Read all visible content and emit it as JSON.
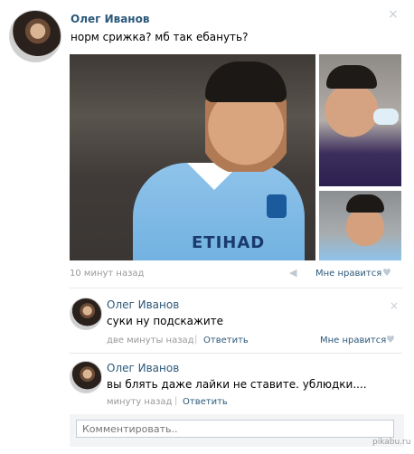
{
  "post": {
    "author": "Олег Иванов",
    "text": "норм срижка? мб так ебануть?",
    "time": "10 минут назад",
    "like_label": "Мне нравится",
    "close_icon": "×",
    "main_photo_sponsor": "ETIHAD"
  },
  "comments": [
    {
      "author": "Олег Иванов",
      "text": "суки ну подскажите",
      "time": "две минуты назад",
      "reply_label": "Ответить",
      "like_label": "Мне нравится",
      "separator": "|"
    },
    {
      "author": "Олег Иванов",
      "text": "вы блять даже лайки не ставите. ублюдки....",
      "time": "минуту назад",
      "reply_label": "Ответить",
      "separator": "|"
    }
  ],
  "comment_input": {
    "placeholder": "Комментировать.."
  },
  "watermark": "pikabu.ru",
  "icons": {
    "heart": "♥",
    "megaphone": "◀",
    "close": "×"
  }
}
